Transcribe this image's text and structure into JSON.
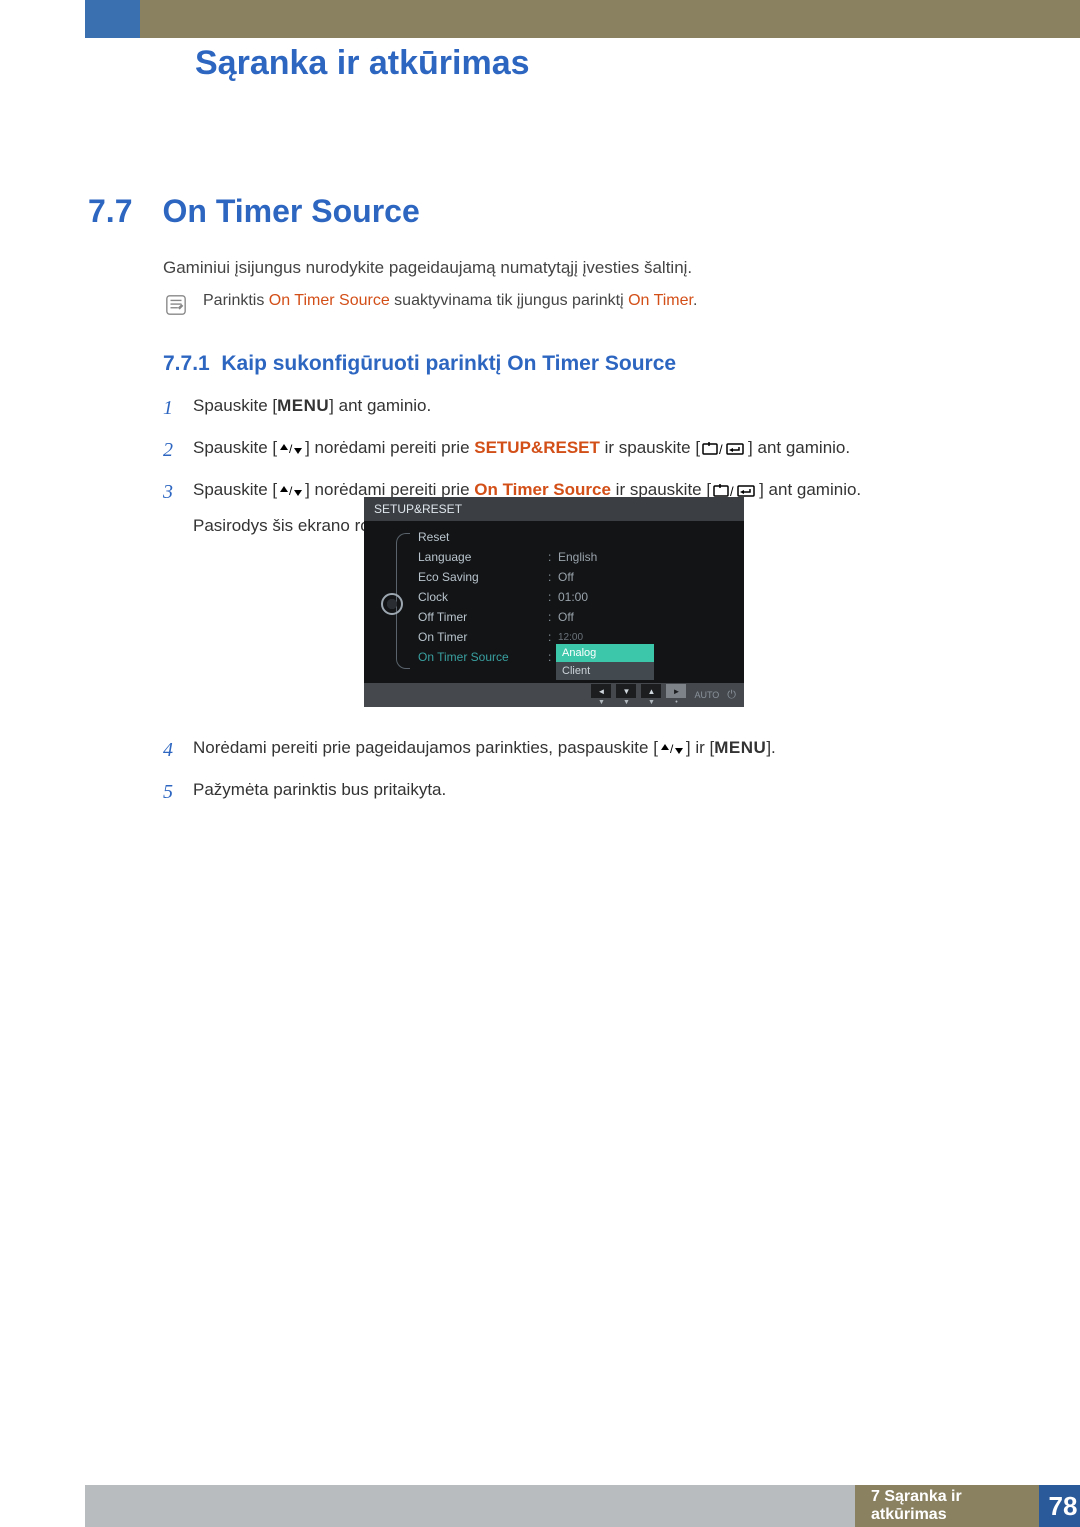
{
  "header": {
    "title": "Sąranka ir atkūrimas"
  },
  "section": {
    "number": "7.7",
    "title": "On Timer Source",
    "intro": "Gaminiui įsijungus nurodykite pageidaujamą numatytąjį įvesties šaltinį.",
    "note_pre": "Parinktis ",
    "note_hl1": "On Timer Source",
    "note_mid": " suaktyvinama tik įjungus parinktį ",
    "note_hl2": "On Timer",
    "note_post": "."
  },
  "subsection": {
    "number": "7.7.1",
    "title": "Kaip sukonfigūruoti parinktį On Timer Source"
  },
  "steps": {
    "s1_pre": "Spauskite [",
    "s1_menu": "MENU",
    "s1_post": "] ant gaminio.",
    "s2_pre": "Spauskite [",
    "s2_mid1": "] norėdami pereiti prie ",
    "s2_hl": "SETUP&RESET",
    "s2_mid2": " ir spauskite [",
    "s2_post": "] ant gaminio.",
    "s3_pre": "Spauskite [",
    "s3_mid1": "] norėdami pereiti prie ",
    "s3_hl": "On Timer Source",
    "s3_mid2": " ir spauskite [",
    "s3_post": "] ant gaminio.",
    "s3_extra": "Pasirodys šis ekrano rodinys:",
    "s4_pre": "Norėdami pereiti prie pageidaujamos parinkties, paspauskite [",
    "s4_mid": "] ir [",
    "s4_menu": "MENU",
    "s4_post": "].",
    "s5": "Pažymėta parinktis bus pritaikyta."
  },
  "osd": {
    "title": "SETUP&RESET",
    "rows": [
      {
        "label": "Reset",
        "val": ""
      },
      {
        "label": "Language",
        "val": "English"
      },
      {
        "label": "Eco Saving",
        "val": "Off"
      },
      {
        "label": "Clock",
        "val": "01:00"
      },
      {
        "label": "Off Timer",
        "val": "Off"
      },
      {
        "label": "On Timer",
        "val": ""
      },
      {
        "label": "On Timer Source",
        "val": ""
      }
    ],
    "obscured_val": "12:00",
    "dropdown": {
      "opt1": "Analog",
      "opt2": "Client"
    },
    "nav": {
      "auto": "AUTO"
    }
  },
  "footer": {
    "chapter": "7 Sąranka ir atkūrimas",
    "page": "78"
  }
}
